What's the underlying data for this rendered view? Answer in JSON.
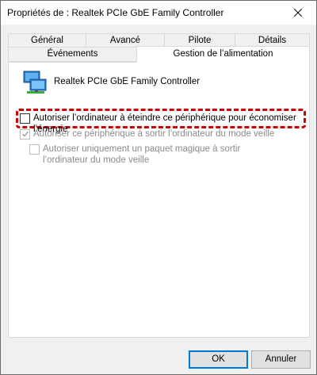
{
  "window": {
    "title": "Propriétés de : Realtek PCIe GbE Family Controller"
  },
  "tabs": {
    "row1": [
      {
        "label": "Général"
      },
      {
        "label": "Avancé"
      },
      {
        "label": "Pilote"
      },
      {
        "label": "Détails"
      }
    ],
    "row2": [
      {
        "label": "Événements"
      },
      {
        "label": "Gestion de l’alimentation",
        "active": true
      }
    ]
  },
  "device": {
    "name": "Realtek PCIe GbE Family Controller",
    "icon": "network-adapter-icon"
  },
  "options": {
    "allow_turn_off": {
      "label": "Autoriser l’ordinateur à éteindre ce périphérique pour économiser l’énergie",
      "checked": false,
      "enabled": true
    },
    "allow_wake": {
      "label": "Autoriser ce périphérique à sortir l’ordinateur du mode veille",
      "checked": true,
      "enabled": false
    },
    "magic_packet_only": {
      "label_line1": "Autoriser uniquement un paquet magique à sortir",
      "label_line2": "l’ordinateur du mode veille",
      "checked": false,
      "enabled": false
    }
  },
  "highlight_color": "#d10000",
  "buttons": {
    "ok": "OK",
    "cancel": "Annuler"
  }
}
